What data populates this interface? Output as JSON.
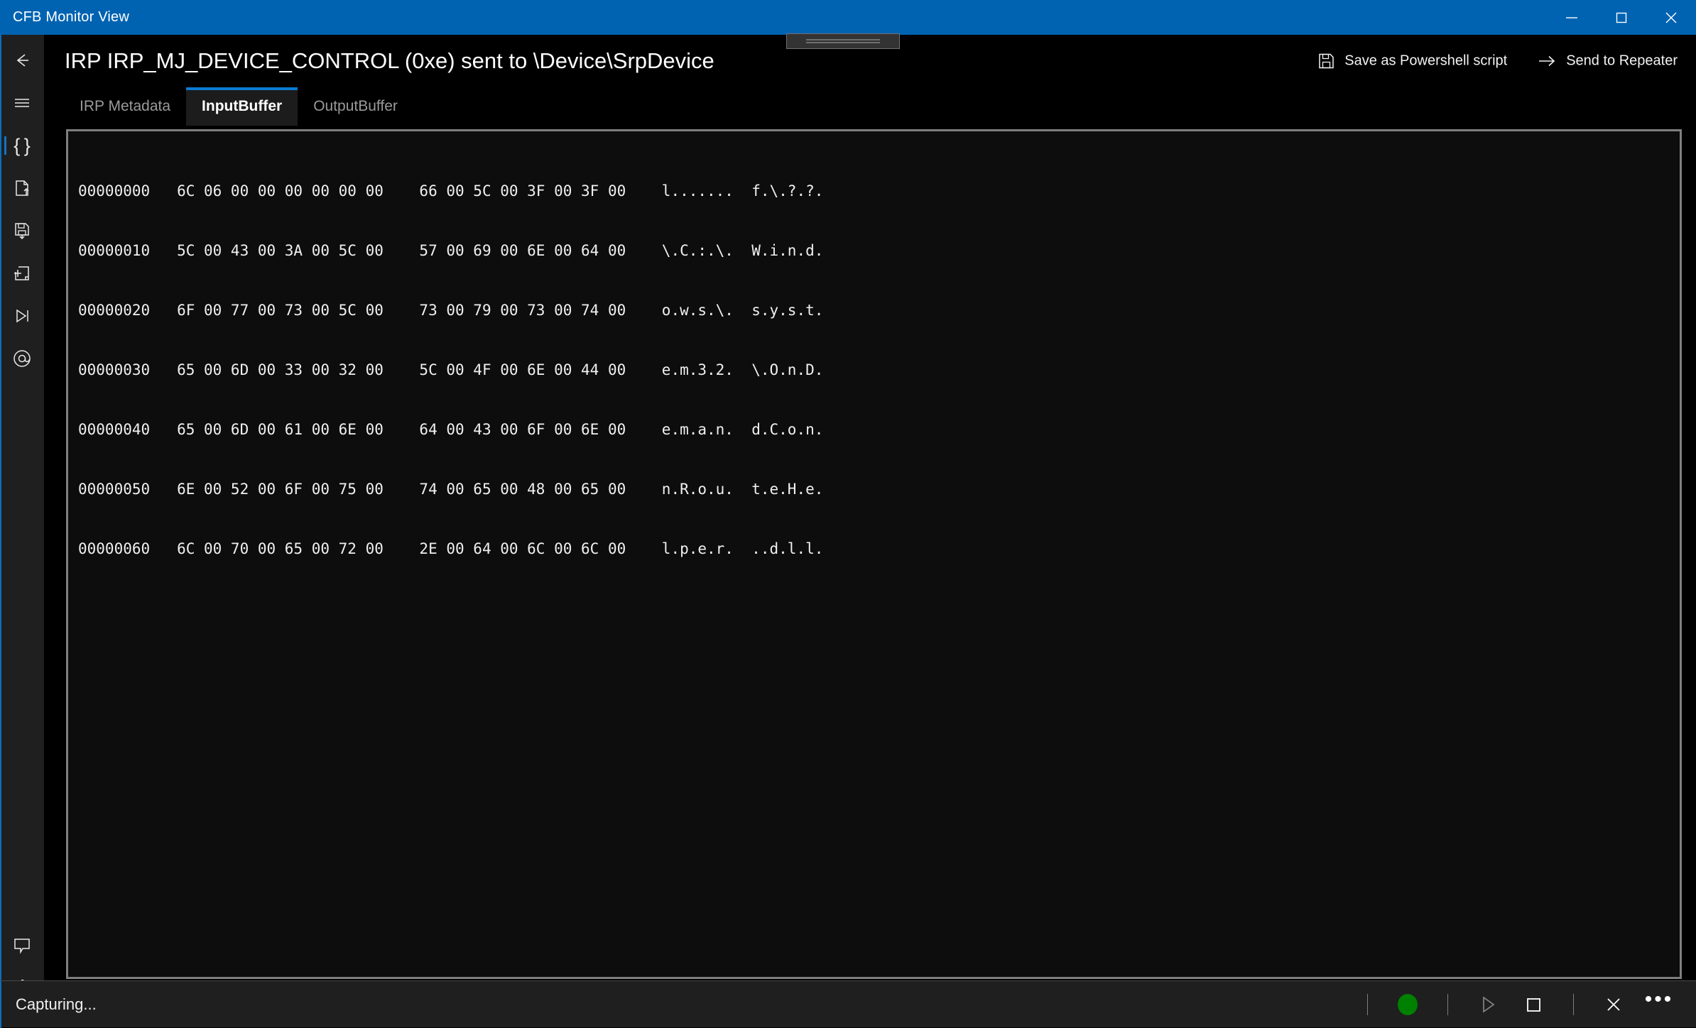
{
  "window": {
    "title": "CFB Monitor View",
    "controls": [
      {
        "name": "minimize",
        "label": "Minimize"
      },
      {
        "name": "maximize",
        "label": "Maximize"
      },
      {
        "name": "close",
        "label": "Close"
      }
    ],
    "titlebar_color": "#0063b1"
  },
  "sidebar": {
    "accent_color": "#0a6ebd",
    "top_items": [
      {
        "icon": "back-arrow-icon",
        "label": "Back"
      },
      {
        "icon": "hamburger-menu-icon",
        "label": "Menu"
      },
      {
        "icon": "braces-icon",
        "label": "IRP Monitor",
        "active": true
      },
      {
        "icon": "file-export-icon",
        "label": "Export"
      },
      {
        "icon": "save-disk-icon",
        "label": "Save"
      },
      {
        "icon": "add-page-icon",
        "label": "New"
      },
      {
        "icon": "play-to-end-icon",
        "label": "Replay"
      },
      {
        "icon": "at-sign-icon",
        "label": "Address"
      }
    ],
    "bottom_items": [
      {
        "icon": "feedback-comment-icon",
        "label": "Feedback"
      },
      {
        "icon": "settings-gear-icon",
        "label": "Settings"
      }
    ]
  },
  "header": {
    "title": "IRP IRP_MJ_DEVICE_CONTROL (0xe) sent to \\Device\\SrpDevice",
    "actions": [
      {
        "icon": "save-disk-icon",
        "label": "Save as Powershell script"
      },
      {
        "icon": "arrow-right-icon",
        "label": "Send to Repeater"
      }
    ]
  },
  "tabs": {
    "active_index": 1,
    "items": [
      {
        "label": "IRP Metadata"
      },
      {
        "label": "InputBuffer"
      },
      {
        "label": "OutputBuffer"
      }
    ],
    "active_color": "#0a7bd1"
  },
  "hexdump": {
    "lines": [
      "00000000   6C 06 00 00 00 00 00 00    66 00 5C 00 3F 00 3F 00    l.......  f.\\.?.?.",
      "00000010   5C 00 43 00 3A 00 5C 00    57 00 69 00 6E 00 64 00    \\.C.:.\\.  W.i.n.d.",
      "00000020   6F 00 77 00 73 00 5C 00    73 00 79 00 73 00 74 00    o.w.s.\\.  s.y.s.t.",
      "00000030   65 00 6D 00 33 00 32 00    5C 00 4F 00 6E 00 44 00    e.m.3.2.  \\.O.n.D.",
      "00000040   65 00 6D 00 61 00 6E 00    64 00 43 00 6F 00 6E 00    e.m.a.n.  d.C.o.n.",
      "00000050   6E 00 52 00 6F 00 75 00    74 00 65 00 48 00 65 00    n.R.o.u.  t.e.H.e.",
      "00000060   6C 00 70 00 65 00 72 00    2E 00 64 00 6C 00 6C 00    l.p.e.r.  ..d.l.l."
    ]
  },
  "statusbar": {
    "status_text": "Capturing...",
    "record_color": "#008000",
    "buttons": [
      {
        "icon": "record-dot-icon",
        "label": "Record"
      },
      {
        "icon": "play-icon",
        "label": "Play"
      },
      {
        "icon": "stop-icon",
        "label": "Stop"
      },
      {
        "icon": "close-x-icon",
        "label": "Clear"
      },
      {
        "icon": "overflow-dots-icon",
        "label": "More options"
      }
    ]
  }
}
